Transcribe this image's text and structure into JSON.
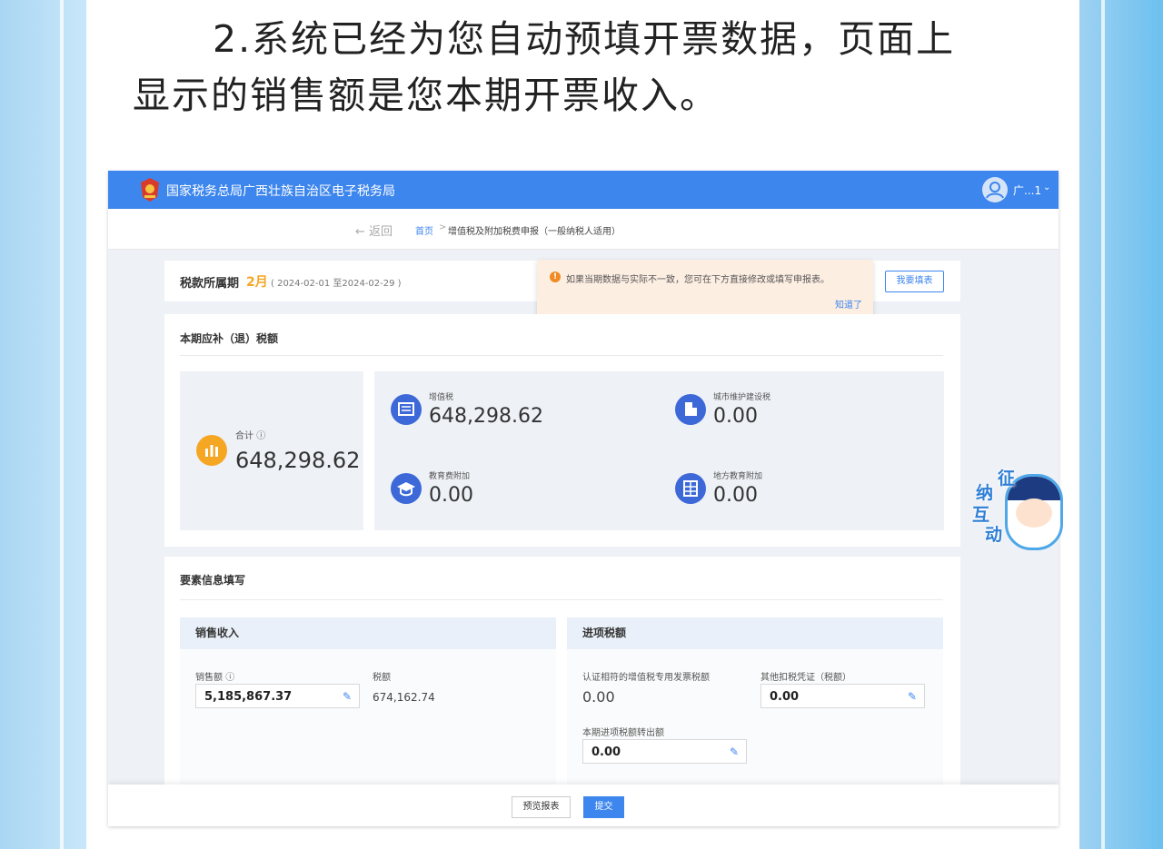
{
  "headline": {
    "line1": "2.系统已经为您自动预填开票数据，页面上",
    "line2": "显示的销售额是您本期开票收入。"
  },
  "app": {
    "title": "国家税务总局广西壮族自治区电子税务局",
    "user": "广...1"
  },
  "breadcrumb": {
    "back": "返回",
    "home": "首页",
    "separator": ">",
    "current": "增值税及附加税费申报（一般纳税人适用）"
  },
  "period": {
    "label": "税款所属期",
    "month": "2月",
    "range": "( 2024-02-01 至2024-02-29 )",
    "fill_button": "我要填表"
  },
  "tip": {
    "message": "如果当期数据与实际不一致，您可在下方直接修改或填写申报表。",
    "ok": "知道了"
  },
  "tax_panel": {
    "heading": "本期应补（退）税额",
    "total_label": "合计",
    "total_value": "648,298.62",
    "items": [
      {
        "label": "增值税",
        "value": "648,298.62",
        "icon": "tax-doc-icon"
      },
      {
        "label": "城市维护建设税",
        "value": "0.00",
        "icon": "building-icon"
      },
      {
        "label": "教育费附加",
        "value": "0.00",
        "icon": "graduation-cap-icon"
      },
      {
        "label": "地方教育附加",
        "value": "0.00",
        "icon": "ledger-icon"
      }
    ]
  },
  "elements": {
    "heading": "要素信息填写",
    "sales": {
      "heading": "销售收入",
      "amount_label": "销售额",
      "amount_value": "5,185,867.37",
      "tax_label": "税额",
      "tax_value": "674,162.74"
    },
    "input_tax": {
      "heading": "进项税额",
      "certified_label": "认证相符的增值税专用发票税额",
      "certified_value": "0.00",
      "other_label": "其他扣税凭证（税额）",
      "other_value": "0.00",
      "transfer_label": "本期进项税额转出额",
      "transfer_value": "0.00"
    }
  },
  "footer": {
    "preview": "预览报表",
    "submit": "提交"
  },
  "mascot": {
    "chars": [
      "征",
      "纳",
      "互",
      "动"
    ]
  },
  "colors": {
    "brand_blue": "#3d86ee",
    "accent_orange": "#f5a623",
    "icon_blue": "#3c68d8",
    "tip_bg": "#fdeee2"
  }
}
